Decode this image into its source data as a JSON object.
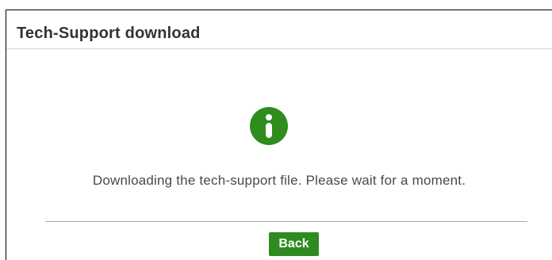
{
  "dialog": {
    "title": "Tech-Support download",
    "message": "Downloading the tech-support file. Please wait for a moment.",
    "icon": "info-icon",
    "back_label": "Back"
  },
  "colors": {
    "accent": "#2e8b1f",
    "icon": "#2f8d1e"
  }
}
